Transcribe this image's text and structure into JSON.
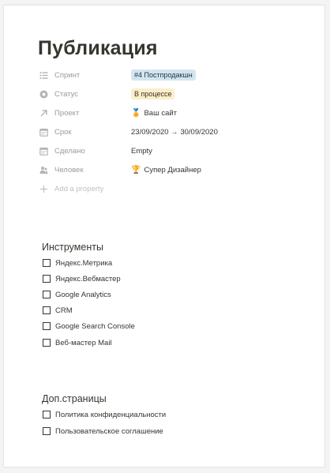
{
  "page": {
    "title": "Публикация"
  },
  "properties": [
    {
      "icon": "list-icon",
      "label": "Спринт",
      "value": "#4 Постпродакшн",
      "style": "tag-blue"
    },
    {
      "icon": "status-icon",
      "label": "Статус",
      "value": "В процессе",
      "style": "tag-yellow"
    },
    {
      "icon": "arrow-up-right-icon",
      "label": "Проект",
      "value": "Ваш сайт",
      "emoji": "🏅",
      "style": "plain"
    },
    {
      "icon": "calendar-icon",
      "label": "Срок",
      "value": "23/09/2020 → 30/09/2020",
      "style": "plain"
    },
    {
      "icon": "calendar-icon",
      "label": "Сделано",
      "value": "Empty",
      "style": "empty"
    },
    {
      "icon": "person-icon",
      "label": "Человек",
      "value": "Супер Дизайнер",
      "emoji": "🏆",
      "style": "plain"
    }
  ],
  "add_property": "Add a property",
  "sections": [
    {
      "heading": "Инструменты",
      "items": [
        "Яндекс.Метрика",
        "Яндекс.Вебмастер",
        "Google Analytics",
        "CRM",
        "Google Search Console",
        "Веб-мастер Mail"
      ]
    },
    {
      "heading": "Доп.страницы",
      "items": [
        "Политика конфиденциальности",
        "Пользовательское соглашение"
      ]
    }
  ],
  "colors": {
    "tag_blue_bg": "#d3e5ef",
    "tag_yellow_bg": "#fbeecb",
    "text": "#37352f",
    "muted": "#9b9a97"
  }
}
